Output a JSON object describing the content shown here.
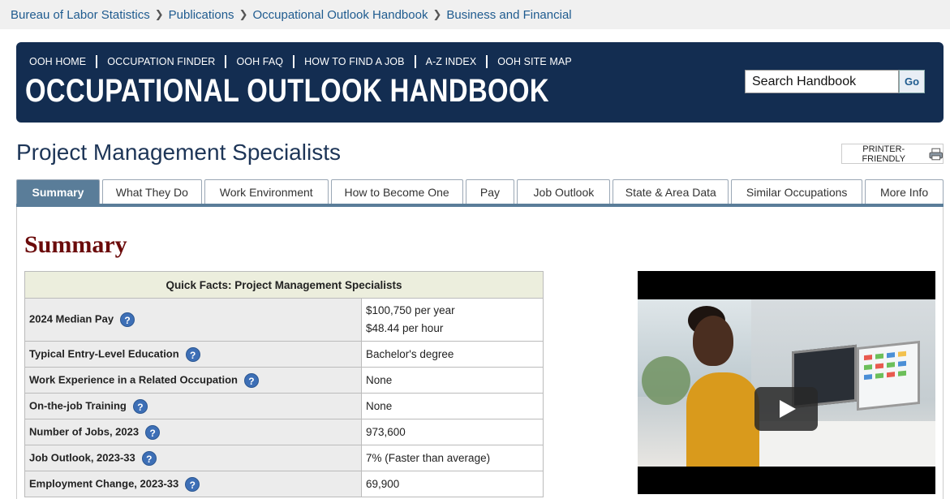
{
  "breadcrumb": {
    "items": [
      "Bureau of Labor Statistics",
      "Publications",
      "Occupational Outlook Handbook",
      "Business and Financial"
    ]
  },
  "banner": {
    "nav": [
      "OOH HOME",
      "OCCUPATION FINDER",
      "OOH FAQ",
      "HOW TO FIND A JOB",
      "A-Z INDEX",
      "OOH SITE MAP"
    ],
    "title": "OCCUPATIONAL OUTLOOK HANDBOOK",
    "search_placeholder": "Search Handbook",
    "go_label": "Go",
    "bg_color": "#132d51"
  },
  "page": {
    "title": "Project Management Specialists",
    "printer_label": "PRINTER-FRIENDLY"
  },
  "tabs": [
    "Summary",
    "What They Do",
    "Work Environment",
    "How to Become One",
    "Pay",
    "Job Outlook",
    "State & Area Data",
    "Similar Occupations",
    "More Info"
  ],
  "active_tab": "Summary",
  "summary": {
    "heading": "Summary",
    "quick_facts": {
      "header": "Quick Facts: Project Management Specialists",
      "help_glyph": "?",
      "pay_label": "2024 Median Pay",
      "pay_year": "$100,750 per year",
      "pay_hour": "$48.44 per hour",
      "rows": [
        {
          "label": "Typical Entry-Level Education",
          "value": "Bachelor's degree"
        },
        {
          "label": "Work Experience in a Related Occupation",
          "value": "None"
        },
        {
          "label": "On-the-job Training",
          "value": "None"
        },
        {
          "label": "Number of Jobs, 2023",
          "value": "973,600"
        },
        {
          "label": "Job Outlook, 2023-33",
          "value": "7% (Faster than average)"
        },
        {
          "label": "Employment Change, 2023-33",
          "value": "69,900"
        }
      ]
    }
  },
  "colors": {
    "link": "#1f5b8f",
    "tab_active": "#5a7d99",
    "section_heading": "#6b0b0b",
    "help_icon": "#3d6fb6"
  }
}
